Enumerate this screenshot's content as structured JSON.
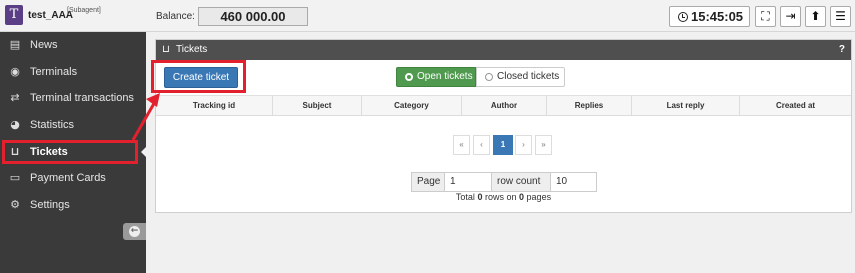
{
  "app": {
    "user_name": "test_AAA",
    "user_role": "[Subagent]",
    "logo_letter": "T"
  },
  "header": {
    "balance_label": "Balance:",
    "balance_value": "460 000.00",
    "clock": "15:45:05",
    "buttons": [
      "fullscreen-icon",
      "logout-icon",
      "arrow-up-icon",
      "menu-icon"
    ]
  },
  "sidebar": {
    "items": [
      {
        "label": "News",
        "icon": "newspaper-icon"
      },
      {
        "label": "Terminals",
        "icon": "gamepad-icon"
      },
      {
        "label": "Terminal transactions",
        "icon": "exchange-icon"
      },
      {
        "label": "Statistics",
        "icon": "pie-chart-icon"
      },
      {
        "label": "Tickets",
        "icon": "inbox-icon",
        "active": true
      },
      {
        "label": "Payment Cards",
        "icon": "credit-card-icon"
      },
      {
        "label": "Settings",
        "icon": "gears-icon"
      }
    ]
  },
  "panel": {
    "title": "Tickets",
    "help": "?",
    "create_label": "Create ticket",
    "tab_open": "Open tickets",
    "tab_closed": "Closed tickets",
    "columns": [
      "Tracking id",
      "Subject",
      "Category",
      "Author",
      "Replies",
      "Last reply",
      "Created at"
    ]
  },
  "pagination": {
    "first": "«",
    "prev": "‹",
    "current": "1",
    "next": "›",
    "last": "»",
    "page_label": "Page",
    "page_value": "1",
    "row_count_label": "row count",
    "row_count_value": "10",
    "total_prefix": "Total",
    "total_rows": "0",
    "total_mid": "rows on",
    "total_pages": "0",
    "total_suffix": "pages"
  },
  "colors": {
    "sidebar_bg": "#3a3a3a",
    "highlight": "#e3202e",
    "primary": "#3a78b5",
    "success": "#4f9a4f",
    "logo": "#5a3f86"
  }
}
